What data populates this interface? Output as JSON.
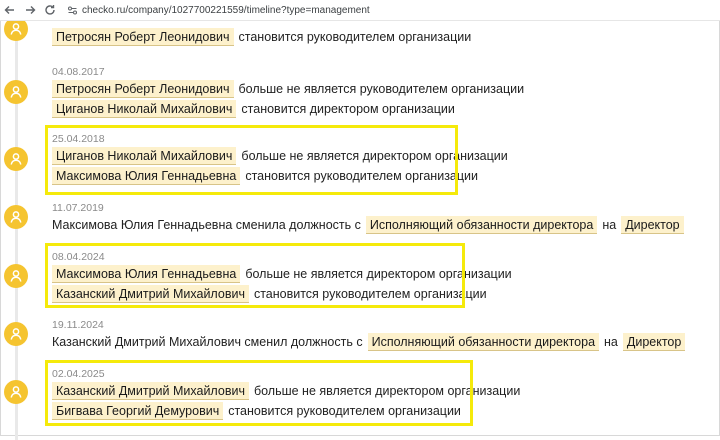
{
  "browser": {
    "back_icon": "arrow-left",
    "forward_icon": "arrow-right",
    "reload_icon": "reload",
    "url": "checko.ru/company/1027700221559/timeline?type=management"
  },
  "entries": [
    {
      "date": "",
      "rows": [
        {
          "parts": [
            {
              "type": "chip",
              "text": "Петросян Роберт Леонидович"
            },
            {
              "type": "text",
              "text": "становится руководителем организации"
            }
          ]
        }
      ]
    },
    {
      "date": "04.08.2017",
      "rows": [
        {
          "parts": [
            {
              "type": "chip",
              "text": "Петросян Роберт Леонидович"
            },
            {
              "type": "text",
              "text": "больше не является руководителем организации"
            }
          ]
        },
        {
          "parts": [
            {
              "type": "chip",
              "text": "Циганов Николай Михайлович"
            },
            {
              "type": "text",
              "text": "становится директором организации"
            }
          ]
        }
      ]
    },
    {
      "date": "25.04.2018",
      "highlighted": true,
      "rows": [
        {
          "parts": [
            {
              "type": "chip",
              "text": "Циганов Николай Михайлович"
            },
            {
              "type": "text",
              "text": "больше не является директором организации"
            }
          ]
        },
        {
          "parts": [
            {
              "type": "chip",
              "text": "Максимова Юлия Геннадьевна"
            },
            {
              "type": "text",
              "text": "становится руководителем организации"
            }
          ]
        }
      ]
    },
    {
      "date": "11.07.2019",
      "rows": [
        {
          "parts": [
            {
              "type": "text",
              "text": "Максимова Юлия Геннадьевна сменила должность с"
            },
            {
              "type": "chip",
              "text": "Исполняющий обязанности директора"
            },
            {
              "type": "text",
              "text": "на"
            },
            {
              "type": "chip",
              "text": "Директор"
            }
          ]
        }
      ]
    },
    {
      "date": "08.04.2024",
      "highlighted": true,
      "rows": [
        {
          "parts": [
            {
              "type": "chip",
              "text": "Максимова Юлия Геннадьевна"
            },
            {
              "type": "text",
              "text": "больше не является директором организации"
            }
          ]
        },
        {
          "parts": [
            {
              "type": "chip",
              "text": "Казанский Дмитрий Михайлович"
            },
            {
              "type": "text",
              "text": "становится руководителем организации"
            }
          ]
        }
      ]
    },
    {
      "date": "19.11.2024",
      "rows": [
        {
          "parts": [
            {
              "type": "text",
              "text": "Казанский Дмитрий Михайлович сменил должность с"
            },
            {
              "type": "chip",
              "text": "Исполняющий обязанности директора"
            },
            {
              "type": "text",
              "text": "на"
            },
            {
              "type": "chip",
              "text": "Директор"
            }
          ]
        }
      ]
    },
    {
      "date": "02.04.2025",
      "highlighted": true,
      "rows": [
        {
          "parts": [
            {
              "type": "chip",
              "text": "Казанский Дмитрий Михайлович"
            },
            {
              "type": "text",
              "text": "больше не является директором организации"
            }
          ]
        },
        {
          "parts": [
            {
              "type": "chip",
              "text": "Бигвава Георгий Демурович"
            },
            {
              "type": "text",
              "text": "становится руководителем организации"
            }
          ]
        }
      ]
    }
  ],
  "colors": {
    "avatar": "#f5c430",
    "chip_bg": "#fdf1cc",
    "highlight_frame": "#f5ea0a",
    "date_text": "#8a8a8a"
  }
}
